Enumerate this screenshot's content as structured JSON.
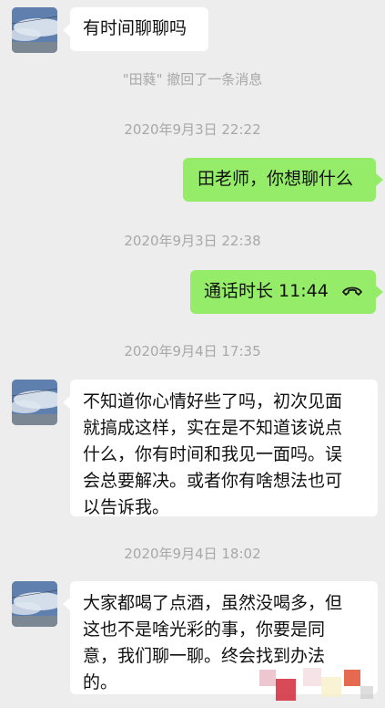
{
  "messages": {
    "m1_text": "有时间聊聊吗",
    "recall_notice": "\"田蕤\" 撤回了一条消息",
    "ts1": "2020年9月3日 22:22",
    "m2_text": "田老师，你想聊什么",
    "ts2": "2020年9月3日 22:38",
    "call_label": "通话时长 11:44",
    "ts3": "2020年9月4日 17:35",
    "m3_lines": [
      "不知道你心情好些了吗，初次见面",
      "就搞成这样，实在是不知道该说点",
      "什么，你有时间和我见一面吗。误",
      "会总要解决。或者你有啥想法也可",
      "以告诉我。"
    ],
    "ts4": "2020年9月4日 18:02",
    "m4_lines": [
      "大家都喝了点酒，虽然没喝多，但",
      "这也不是啥光彩的事，你要是同",
      "意，我们聊一聊。终会找到办法",
      "的。"
    ]
  },
  "icons": {
    "avatar": "avatar-sky-photo",
    "call": "phone-hangup-icon"
  },
  "colors": {
    "background": "#ededed",
    "incoming_bubble": "#ffffff",
    "outgoing_bubble": "#95ec69",
    "timestamp_text": "#a8a8a8"
  }
}
